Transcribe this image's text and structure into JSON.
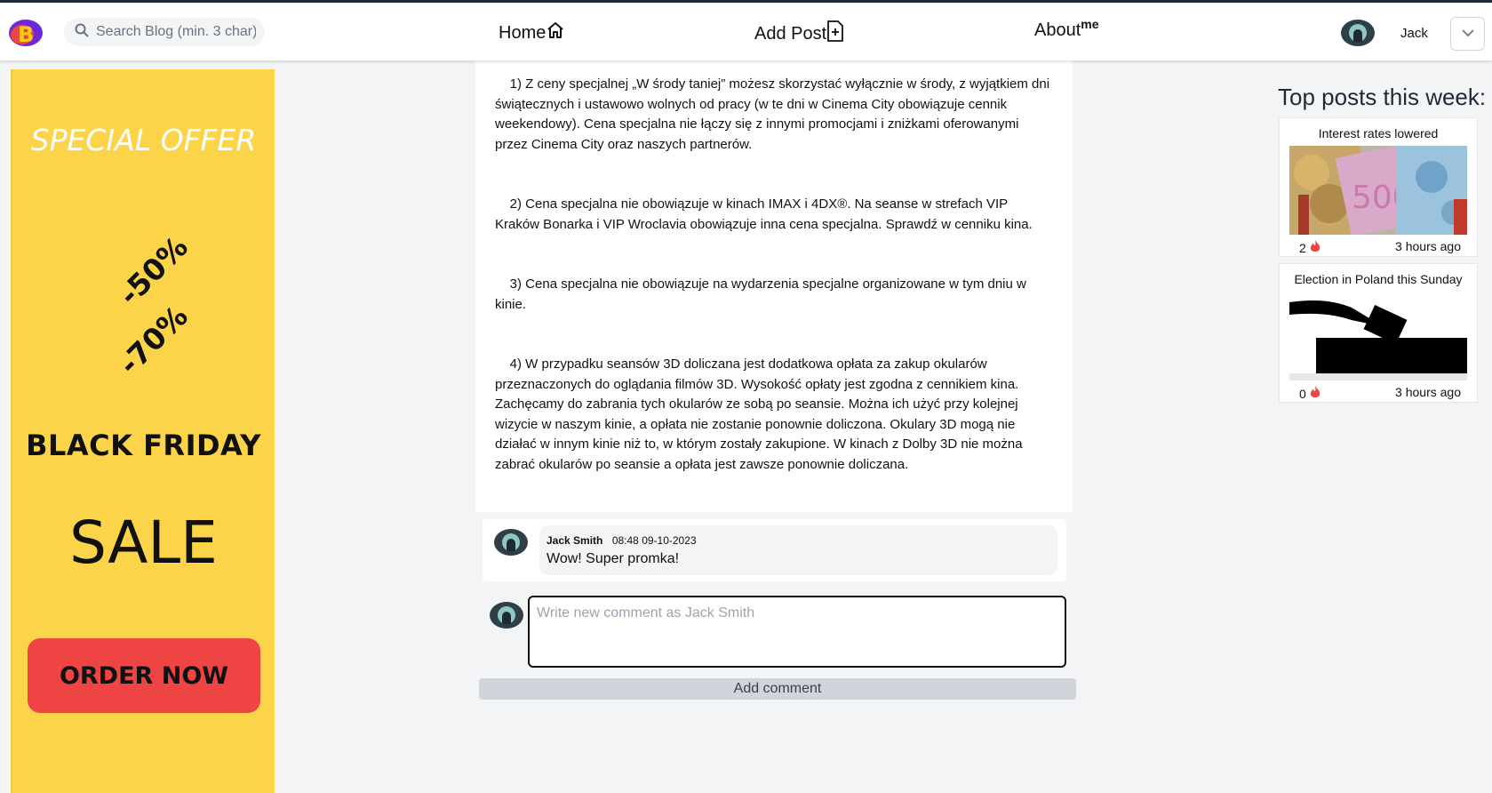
{
  "header": {
    "search_placeholder": "Search Blog (min. 3 char)",
    "nav": {
      "home": "Home",
      "add_post": "Add Post",
      "about": "About",
      "about_sup": "me"
    },
    "user_name": "Jack"
  },
  "ad": {
    "special": "SPECIAL OFFER",
    "discount1": "-50%",
    "discount2": "-70%",
    "black_friday": "BLACK FRIDAY",
    "sale": "SALE",
    "order": "ORDER NOW",
    "colors": {
      "background": "#fbd44a",
      "button": "#ef4444"
    }
  },
  "article": {
    "paragraphs": [
      "    1) Z ceny specjalnej „W środy taniej” możesz skorzystać wyłącznie w środy, z wyjątkiem dni świątecznych i ustawowo wolnych od pracy (w te dni w Cinema City obowiązuje cennik weekendowy). Cena specjalna nie łączy się z innymi promocjami i zniżkami oferowanymi przez Cinema City oraz naszych partnerów.",
      "    2) Cena specjalna nie obowiązuje w kinach IMAX i 4DX®. Na seanse w strefach VIP Kraków Bonarka i VIP Wroclavia obowiązuje inna cena specjalna. Sprawdź w cenniku kina.",
      "    3) Cena specjalna nie obowiązuje na wydarzenia specjalne organizowane w tym dniu w kinie.",
      "    4) W przypadku seansów 3D doliczana jest dodatkowa opłata za zakup okularów przeznaczonych do oglądania filmów 3D. Wysokość opłaty jest zgodna z cennikiem kina. Zachęcamy do zabrania tych okularów ze sobą po seansie. Można ich użyć przy kolejnej wizycie w naszym kinie, a opłata nie zostanie ponownie doliczona. Okulary 3D mogą nie działać w innym kinie niż to, w którym zostały zakupione. W kinach z Dolby 3D nie można zabrać okularów po seansie a opłata jest zawsze ponownie doliczana."
    ]
  },
  "comments": [
    {
      "author": "Jack Smith",
      "date": "08:48 09-10-2023",
      "text": "Wow! Super promka!"
    }
  ],
  "new_comment": {
    "placeholder": "Write new comment as Jack Smith",
    "button": "Add comment"
  },
  "sidebar": {
    "title": "Top posts this week:",
    "posts": [
      {
        "title": "Interest rates lowered",
        "likes": "2",
        "time": "3 hours ago",
        "image": "euro-banknotes-coins"
      },
      {
        "title": "Election in Poland this Sunday",
        "likes": "0",
        "time": "3 hours ago",
        "image": "ballot-box-silhouette"
      }
    ]
  }
}
